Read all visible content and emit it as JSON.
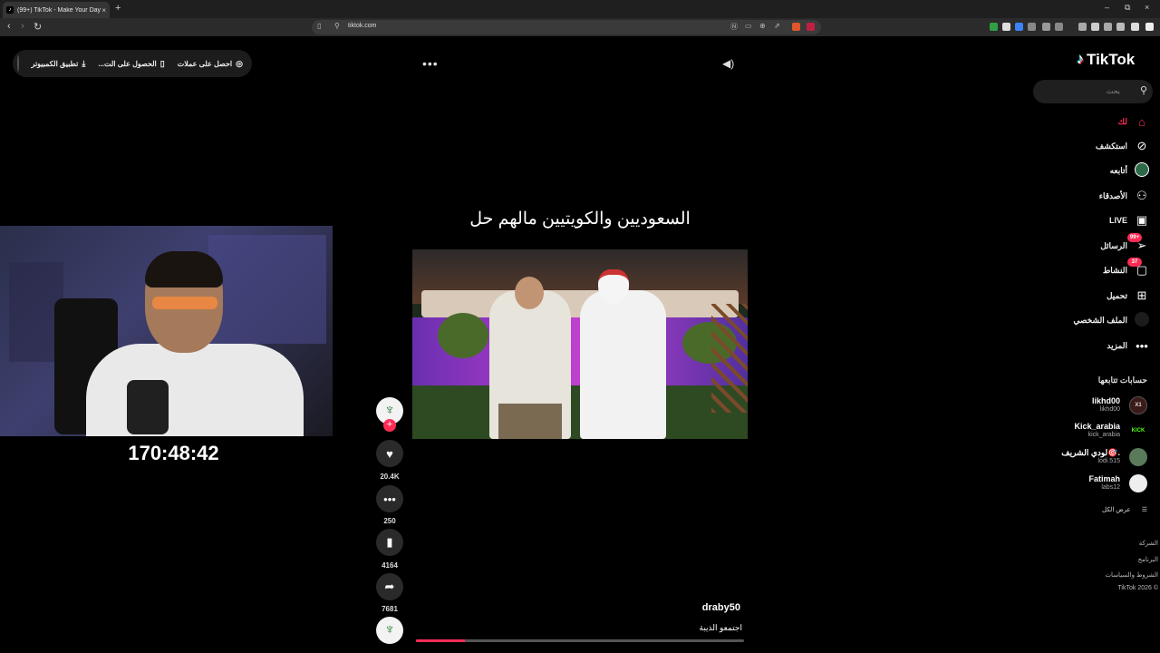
{
  "browser": {
    "tab_title": "(99+) TikTok - Make Your Day",
    "tab_close": "×",
    "new_tab": "+",
    "url": "tiktok.com",
    "window_controls": [
      "–",
      "⧉",
      "×"
    ]
  },
  "top_bar": {
    "offers": "احصل على عملات",
    "get_app": "الحصول على الت...",
    "desktop_app": "تطبيق الكمبيوتر"
  },
  "stream_overlay": {
    "timer": "170:48:42"
  },
  "video": {
    "caption_title": "السعوديين والكويتيين مالهم حل",
    "author": "draby50",
    "description": "اجتمعو الذيبة",
    "progress_fraction": 0.15
  },
  "actions": {
    "likes": "20.4K",
    "comments": "250",
    "saves": "4164",
    "shares": "7681"
  },
  "sidebar": {
    "logo": "TikTok",
    "search_placeholder": "بحث",
    "nav": [
      {
        "label": "لك",
        "icon": "home-icon",
        "active": true
      },
      {
        "label": "استكشف",
        "icon": "compass-icon"
      },
      {
        "label": "أتابعه",
        "icon": "following-avatar"
      },
      {
        "label": "الأصدقاء",
        "icon": "friends-icon"
      },
      {
        "label": "LIVE",
        "icon": "live-icon"
      },
      {
        "label": "الرسائل",
        "icon": "messages-icon",
        "badge": "99+"
      },
      {
        "label": "النشاط",
        "icon": "activity-icon",
        "badge": "37"
      },
      {
        "label": "تحميل",
        "icon": "upload-icon"
      },
      {
        "label": "الملف الشخصي",
        "icon": "profile-avatar"
      },
      {
        "label": "المزيد",
        "icon": "more-icon"
      }
    ],
    "following_title": "حسابات تتابعها",
    "following": [
      {
        "name": "likhd00",
        "handle": "likhd00",
        "badge": "X1"
      },
      {
        "name": "Kick_arabia",
        "handle": "kick_arabia",
        "badge": "KICK"
      },
      {
        "name": "لودي الشريف🎯.",
        "handle": "lodi.515",
        "badge": ""
      },
      {
        "name": "Fatimah",
        "handle": "labs12",
        "badge": ""
      }
    ],
    "see_all": "عرض الكل",
    "footer": [
      "الشركة",
      "البرنامج",
      "الشروط والسياسات",
      "© 2026 TikTok"
    ]
  },
  "colors": {
    "accent": "#fe2c55",
    "background": "#000000",
    "chrome": "#2b2b2b"
  }
}
